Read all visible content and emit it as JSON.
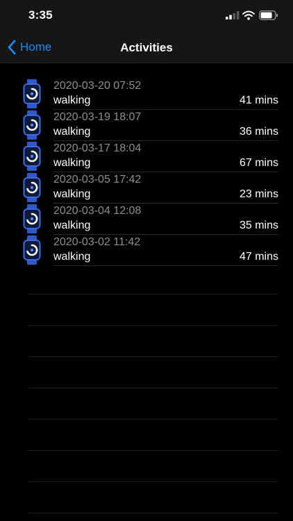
{
  "status_bar": {
    "time": "3:35",
    "icons": [
      "cellular-signal-icon",
      "wifi-icon",
      "battery-icon"
    ]
  },
  "nav": {
    "back_label": "Home",
    "title": "Activities"
  },
  "colors": {
    "background": "#000000",
    "bar_background": "#161616",
    "accent": "#1a8cff",
    "secondary_text": "#8e8e93",
    "watch_icon": "#2f59c9"
  },
  "activities": [
    {
      "date": "2020-03-20 07:52",
      "type": "walking",
      "duration": "41 mins"
    },
    {
      "date": "2020-03-19 18:07",
      "type": "walking",
      "duration": "36 mins"
    },
    {
      "date": "2020-03-17 18:04",
      "type": "walking",
      "duration": "67 mins"
    },
    {
      "date": "2020-03-05 17:42",
      "type": "walking",
      "duration": "23 mins"
    },
    {
      "date": "2020-03-04 12:08",
      "type": "walking",
      "duration": "35 mins"
    },
    {
      "date": "2020-03-02 11:42",
      "type": "walking",
      "duration": "47 mins"
    }
  ]
}
